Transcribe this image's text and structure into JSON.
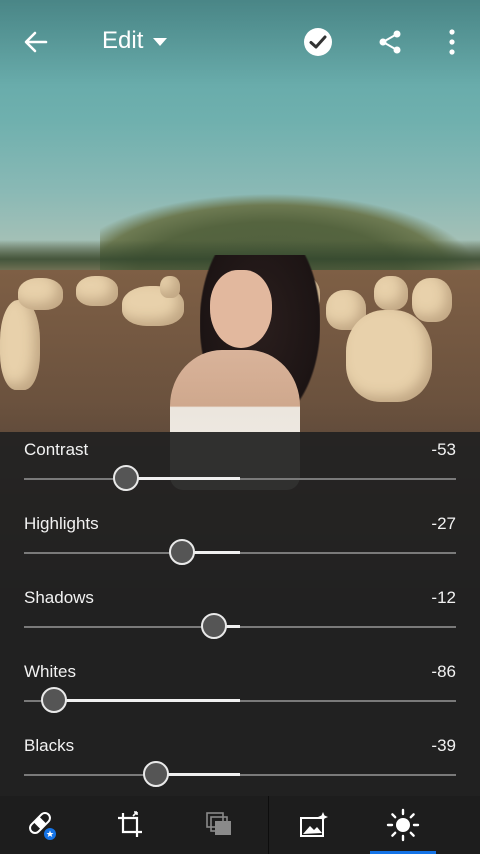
{
  "header": {
    "title": "Edit"
  },
  "sliders": [
    {
      "label": "Contrast",
      "value": "-53",
      "numeric": -53
    },
    {
      "label": "Highlights",
      "value": "-27",
      "numeric": -27
    },
    {
      "label": "Shadows",
      "value": "-12",
      "numeric": -12
    },
    {
      "label": "Whites",
      "value": "-86",
      "numeric": -86
    },
    {
      "label": "Blacks",
      "value": "-39",
      "numeric": -39
    }
  ],
  "toolbar": {
    "active_tool": "light",
    "accent_color": "#1473e6"
  }
}
